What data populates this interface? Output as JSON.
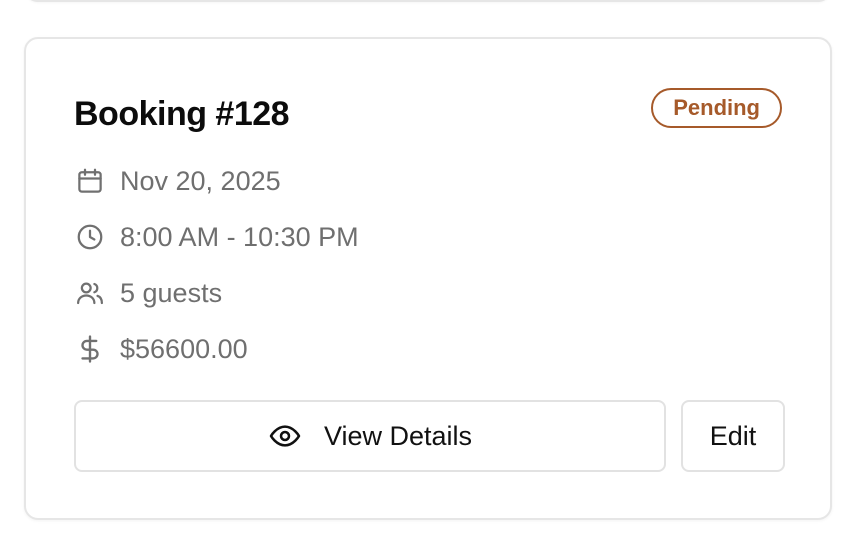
{
  "booking": {
    "title": "Booking #128",
    "status": "Pending",
    "status_color": "#a65a2a",
    "date": "Nov 20, 2025",
    "time": "8:00 AM - 10:30 PM",
    "guests": "5 guests",
    "price": "$56600.00",
    "icons": [
      "calendar-icon",
      "clock-icon",
      "users-icon",
      "dollar-icon"
    ]
  },
  "actions": {
    "view_label": "View Details",
    "view_icon": "eye-icon",
    "edit_label": "Edit"
  }
}
